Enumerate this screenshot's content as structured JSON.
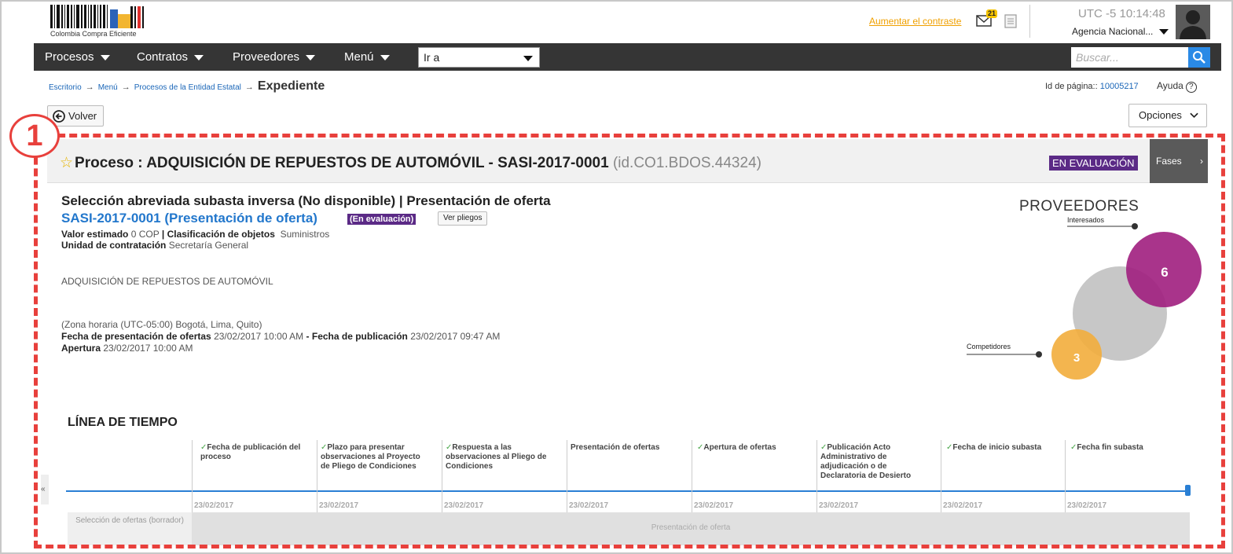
{
  "header": {
    "logo_text": "Colombia Compra Eficiente",
    "contrast_link": "Aumentar el contraste",
    "mail_count": "21",
    "timezone": "UTC -5",
    "time": "10:14:48",
    "agency": "Agencia Nacional..."
  },
  "nav": {
    "items": [
      "Procesos",
      "Contratos",
      "Proveedores",
      "Menú"
    ],
    "goto_label": "Ir a",
    "search_placeholder": "Buscar..."
  },
  "breadcrumb": {
    "items": [
      "Escritorio",
      "Menú",
      "Procesos de la Entidad Estatal"
    ],
    "current": "Expediente",
    "page_id_label": "Id de página::",
    "page_id": "10005217",
    "help": "Ayuda"
  },
  "actions": {
    "back": "Volver",
    "options": "Opciones"
  },
  "callout": "1",
  "process": {
    "title": "Proceso : ADQUISICIÓN DE REPUESTOS DE AUTOMÓVIL - SASI-2017-0001",
    "id": "(id.CO1.BDOS.44324)",
    "status": "EN EVALUACIÓN",
    "phases_button": "Fases",
    "selection_title": "Selección abreviada subasta inversa (No disponible) | Presentación de oferta",
    "code_link": "SASI-2017-0001 (Presentación de oferta)",
    "eval_badge": "(En evaluación)",
    "ver_pliegos": "Ver pliegos",
    "valor_label": "Valor estimado",
    "valor": "0 COP",
    "clasif_label": "Clasificación de objetos",
    "clasif": "Suministros",
    "unidad_label": "Unidad de contratación",
    "unidad": "Secretaría General",
    "description": "ADQUISICIÓN DE REPUESTOS DE AUTOMÓVIL",
    "timezone": "(Zona horaria (UTC-05:00) Bogotá, Lima, Quito)",
    "fecha_pres_label": "Fecha de presentación de ofertas",
    "fecha_pres": "23/02/2017 10:00 AM",
    "fecha_pub_label": "Fecha de publicación",
    "fecha_pub": "23/02/2017 09:47 AM",
    "apertura_label": "Apertura",
    "apertura": "23/02/2017 10:00 AM"
  },
  "providers": {
    "title": "PROVEEDORES",
    "interesados_label": "Interesados",
    "interesados": "6",
    "competidores_label": "Competidores",
    "competidores": "3",
    "colors": {
      "interesados": "#a01e7e",
      "competidores": "#f2ad3c",
      "total": "#bdbdbd"
    }
  },
  "timeline": {
    "title": "LÍNEA DE TIEMPO",
    "steps": [
      {
        "label": "Fecha de publicación del proceso",
        "date": "23/02/2017",
        "done": true
      },
      {
        "label": "Plazo para presentar observaciones al Proyecto de Pliego de Condiciones",
        "date": "23/02/2017",
        "done": true
      },
      {
        "label": "Respuesta a las observaciones al Pliego de Condiciones",
        "date": "23/02/2017",
        "done": true
      },
      {
        "label": "Presentación de ofertas",
        "date": "23/02/2017",
        "done": false
      },
      {
        "label": "Apertura de ofertas",
        "date": "23/02/2017",
        "done": true
      },
      {
        "label": "Publicación Acto Administrativo de adjudicación o de Declaratoria de Desierto",
        "date": "23/02/2017",
        "done": true
      },
      {
        "label": "Fecha de inicio subasta",
        "date": "23/02/2017",
        "done": true
      },
      {
        "label": "Fecha fin subasta",
        "date": "23/02/2017",
        "done": true
      }
    ],
    "phase_draft": "Selección de ofertas (borrador)",
    "phase_current": "Presentación de oferta",
    "scroll_glyph": "«"
  }
}
